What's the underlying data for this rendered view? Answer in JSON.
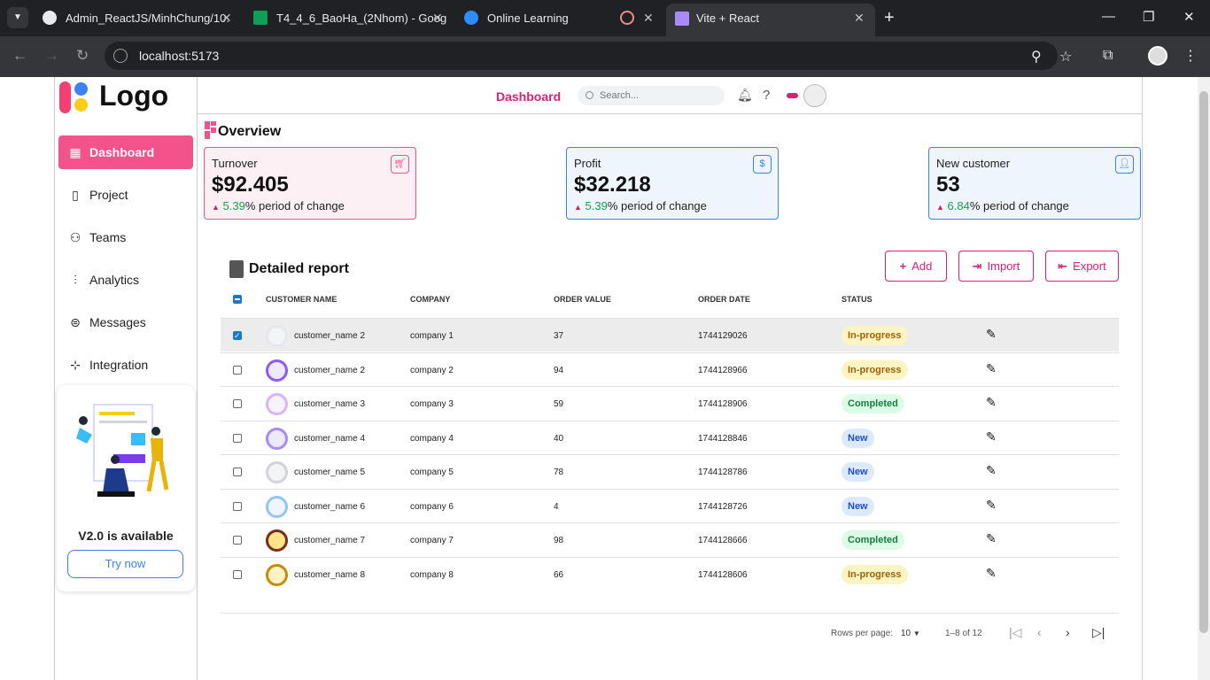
{
  "browser": {
    "tabs": [
      {
        "title": "Admin_ReactJS/MinhChung/10.",
        "icon": "github-icon"
      },
      {
        "title": "T4_4_6_BaoHa_(2Nhom) - Goog",
        "icon": "sheets-icon"
      },
      {
        "title": "Online Learning",
        "icon": "zoom-icon"
      },
      {
        "title": "",
        "icon": "record-icon"
      },
      {
        "title": "Vite + React",
        "icon": "vite-icon"
      }
    ],
    "url": "localhost:5173"
  },
  "sidebar": {
    "logo": "Logo",
    "items": [
      {
        "label": "Dashboard",
        "icon": "grid-icon",
        "active": true
      },
      {
        "label": "Project",
        "icon": "file-icon"
      },
      {
        "label": "Teams",
        "icon": "users-icon"
      },
      {
        "label": "Analytics",
        "icon": "chart-icon"
      },
      {
        "label": "Messages",
        "icon": "message-icon"
      },
      {
        "label": "Integration",
        "icon": "integration-icon"
      }
    ],
    "promo": {
      "text": "V2.0 is available",
      "button": "Try now"
    }
  },
  "header": {
    "title": "Dashboard",
    "search_placeholder": "Search..."
  },
  "overview": {
    "title": "Overview",
    "cards": [
      {
        "label": "Turnover",
        "value": "$92.405",
        "pct": "5.39",
        "suffix": "% period of change",
        "color": "#f3528a",
        "bg": "#fdf0f4",
        "icon": "cart-icon"
      },
      {
        "label": "Profit",
        "value": "$32.218",
        "pct": "5.39",
        "suffix": "% period of change",
        "color": "#3b82f6",
        "bg": "#eef5fd",
        "icon": "dollar-icon"
      },
      {
        "label": "New customer",
        "value": "53",
        "pct": "6.84",
        "suffix": "% period of change",
        "color": "#3b82f6",
        "bg": "#eef5fd",
        "icon": "user-icon"
      }
    ]
  },
  "report": {
    "title": "Detailed report",
    "buttons": {
      "add": "Add",
      "import": "Import",
      "export": "Export"
    },
    "columns": [
      "CUSTOMER NAME",
      "COMPANY",
      "ORDER VALUE",
      "ORDER DATE",
      "STATUS"
    ],
    "rows": [
      {
        "name": "customer_name 2",
        "company": "company 1",
        "value": "37",
        "date": "1744129026",
        "status": "In-progress",
        "selected": true
      },
      {
        "name": "customer_name 2",
        "company": "company 2",
        "value": "94",
        "date": "1744128966",
        "status": "In-progress",
        "selected": false
      },
      {
        "name": "customer_name 3",
        "company": "company 3",
        "value": "59",
        "date": "1744128906",
        "status": "Completed",
        "selected": false
      },
      {
        "name": "customer_name 4",
        "company": "company 4",
        "value": "40",
        "date": "1744128846",
        "status": "New",
        "selected": false
      },
      {
        "name": "customer_name 5",
        "company": "company 5",
        "value": "78",
        "date": "1744128786",
        "status": "New",
        "selected": false
      },
      {
        "name": "customer_name 6",
        "company": "company 6",
        "value": "4",
        "date": "1744128726",
        "status": "New",
        "selected": false
      },
      {
        "name": "customer_name 7",
        "company": "company 7",
        "value": "98",
        "date": "1744128666",
        "status": "Completed",
        "selected": false
      },
      {
        "name": "customer_name 8",
        "company": "company 8",
        "value": "66",
        "date": "1744128606",
        "status": "In-progress",
        "selected": false
      }
    ],
    "status_colors": {
      "In-progress": {
        "bg": "#fdf4c3",
        "fg": "#a16207"
      },
      "Completed": {
        "bg": "#dcfce7",
        "fg": "#15803d"
      },
      "New": {
        "bg": "#dbeafe",
        "fg": "#1d4ed8"
      }
    },
    "pagination": {
      "rows_label": "Rows per page:",
      "rows_value": "10",
      "range": "1–8 of 12"
    }
  }
}
